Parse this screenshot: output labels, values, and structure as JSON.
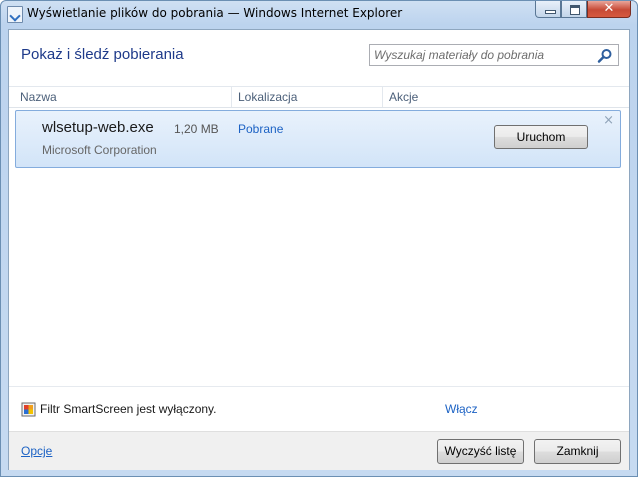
{
  "window": {
    "title": "Wyświetlanie plików do pobrania — Windows Internet Explorer",
    "close_glyph": "✕"
  },
  "header": {
    "title": "Pokaż i śledź pobierania",
    "search_placeholder": "Wyszukaj materiały do pobrania"
  },
  "columns": {
    "name": "Nazwa",
    "location": "Lokalizacja",
    "actions": "Akcje"
  },
  "downloads": [
    {
      "filename": "wlsetup-web.exe",
      "size": "1,20 MB",
      "publisher": "Microsoft Corporation",
      "location": "Pobrane",
      "action": "Uruchom",
      "remove_glyph": "×"
    }
  ],
  "smartscreen": {
    "status": "Filtr SmartScreen jest wyłączony.",
    "enable_link": "Włącz"
  },
  "footer": {
    "options": "Opcje",
    "clear_list": "Wyczyść listę",
    "close": "Zamknij"
  },
  "colors": {
    "heading": "#1e3a8a",
    "link": "#1c62c4",
    "row_selected": "#d2e4f8"
  }
}
